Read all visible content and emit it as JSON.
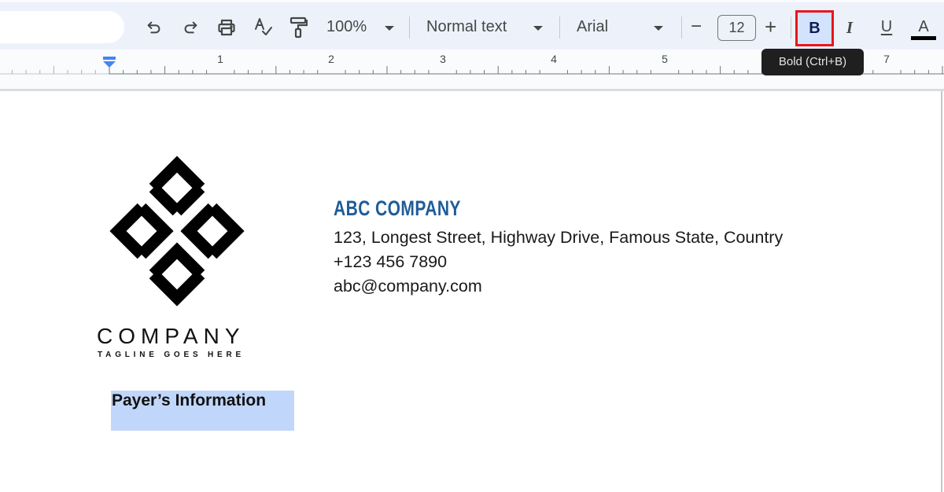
{
  "toolbar": {
    "undo": "undo-icon",
    "redo": "redo-icon",
    "print": "print-icon",
    "spellcheck": "spellcheck-icon",
    "paint_format": "paint-format-icon",
    "zoom_value": "100%",
    "style_value": "Normal text",
    "font_value": "Arial",
    "decrease_label": "−",
    "font_size": "12",
    "increase_label": "+",
    "bold_label": "B",
    "italic_label": "I",
    "underline_label": "U",
    "text_color_label": "A",
    "text_color": "#000000",
    "bold_active": true
  },
  "tooltip": {
    "text": "Bold (Ctrl+B)"
  },
  "ruler": {
    "numbers": [
      "1",
      "2",
      "3",
      "4",
      "5",
      "7"
    ]
  },
  "document": {
    "logo": {
      "word": "COMPANY",
      "tagline": "TAGLINE GOES HERE"
    },
    "company_name": "ABC COMPANY",
    "company_color": "#1f5c99",
    "address": "123, Longest Street, Highway Drive, Famous State, Country",
    "phone": "+123 456 7890",
    "email": "abc@company.com",
    "selected_heading": "Payer’s Information",
    "selection_color": "#c1d6fb"
  }
}
